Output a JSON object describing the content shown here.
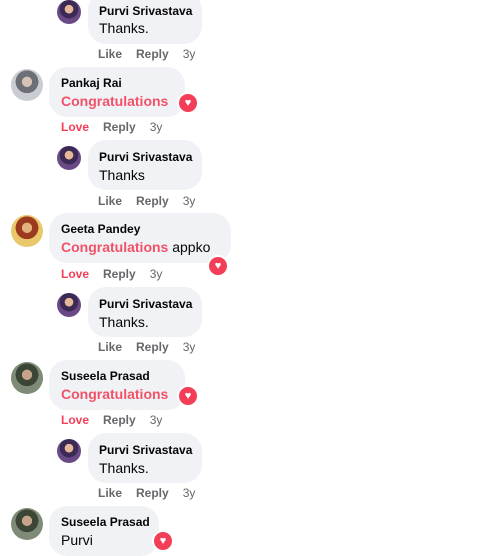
{
  "comments": [
    {
      "author": "Purvi Srivastava",
      "text": "Thanks.",
      "like": "Like",
      "reply": "Reply",
      "time": "3y"
    },
    {
      "author": "Pankaj Rai",
      "text_highlight": "Congratulations",
      "text_rest": "",
      "reaction_icon": "heart-icon",
      "like": "Love",
      "reply": "Reply",
      "time": "3y"
    },
    {
      "author": "Purvi Srivastava",
      "text": "Thanks",
      "like": "Like",
      "reply": "Reply",
      "time": "3y"
    },
    {
      "author": "Geeta Pandey",
      "text_highlight": "Congratulations",
      "text_rest": " appko",
      "reaction_icon": "heart-icon",
      "like": "Love",
      "reply": "Reply",
      "time": "3y"
    },
    {
      "author": "Purvi Srivastava",
      "text": "Thanks.",
      "like": "Like",
      "reply": "Reply",
      "time": "3y"
    },
    {
      "author": "Suseela Prasad",
      "text_highlight": "Congratulations",
      "text_rest": "",
      "reaction_icon": "heart-icon",
      "like": "Love",
      "reply": "Reply",
      "time": "3y"
    },
    {
      "author": "Purvi Srivastava",
      "text": "Thanks.",
      "like": "Like",
      "reply": "Reply",
      "time": "3y"
    },
    {
      "author": "Suseela Prasad",
      "text": "Purvi",
      "reaction_icon": "heart-icon"
    }
  ],
  "colors": {
    "love": "#f33e58",
    "highlight": "#f25268",
    "bubble": "#f0f2f5",
    "meta": "#65676b"
  },
  "glyphs": {
    "heart": "♥"
  }
}
